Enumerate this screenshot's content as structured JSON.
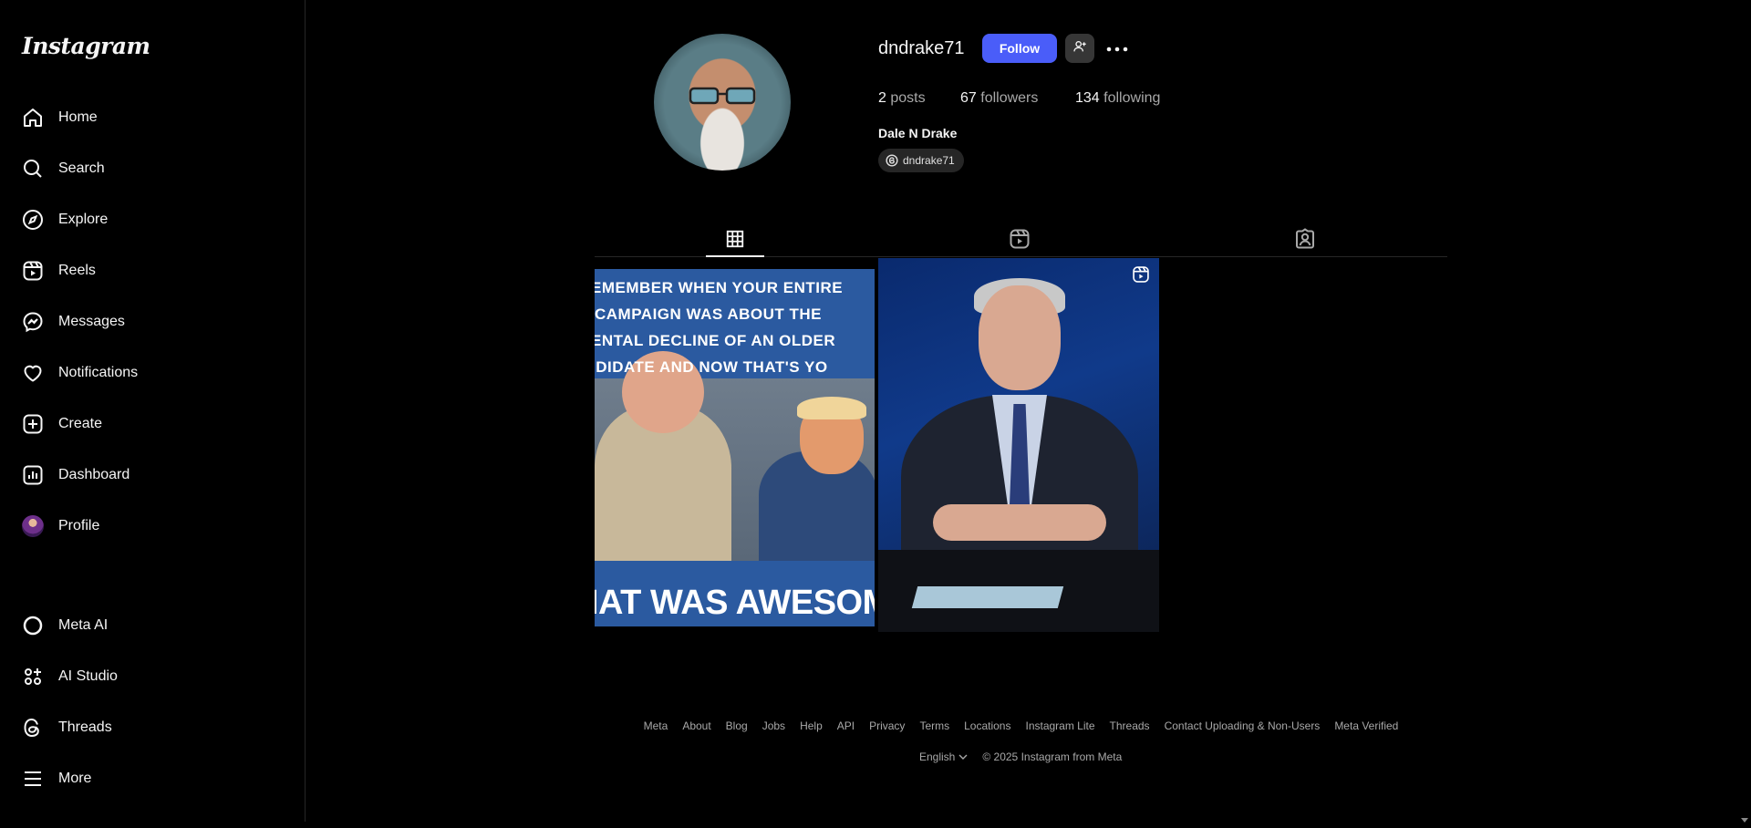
{
  "app": {
    "logo_text": "Instagram"
  },
  "sidebar": {
    "items": [
      {
        "label": "Home"
      },
      {
        "label": "Search"
      },
      {
        "label": "Explore"
      },
      {
        "label": "Reels"
      },
      {
        "label": "Messages"
      },
      {
        "label": "Notifications"
      },
      {
        "label": "Create"
      },
      {
        "label": "Dashboard"
      },
      {
        "label": "Profile"
      }
    ],
    "bottom_items": [
      {
        "label": "Meta AI"
      },
      {
        "label": "AI Studio"
      },
      {
        "label": "Threads"
      },
      {
        "label": "More"
      }
    ]
  },
  "profile": {
    "username": "dndrake71",
    "follow_label": "Follow",
    "posts_count": "2",
    "posts_label": "posts",
    "followers_count": "67",
    "followers_label": "followers",
    "following_count": "134",
    "following_label": "following",
    "full_name": "Dale N Drake",
    "threads_handle": "dndrake71"
  },
  "posts": [
    {
      "caption_lines": [
        "EMEMBER WHEN YOUR ENTIRE",
        "CAMPAIGN WAS ABOUT THE",
        "ENTAL DECLINE OF AN OLDER",
        "IDIDATE AND NOW THAT'S YO"
      ],
      "bottom_text": "IAT WAS AWESOMI"
    },
    {
      "caption_lines": [],
      "bottom_text": ""
    }
  ],
  "footer": {
    "links": [
      "Meta",
      "About",
      "Blog",
      "Jobs",
      "Help",
      "API",
      "Privacy",
      "Terms",
      "Locations",
      "Instagram Lite",
      "Threads",
      "Contact Uploading & Non-Users",
      "Meta Verified"
    ],
    "language": "English",
    "copyright": "© 2025 Instagram from Meta"
  },
  "colors": {
    "accent": "#4a5df9",
    "background": "#000000",
    "muted_text": "#a8a8a8"
  }
}
